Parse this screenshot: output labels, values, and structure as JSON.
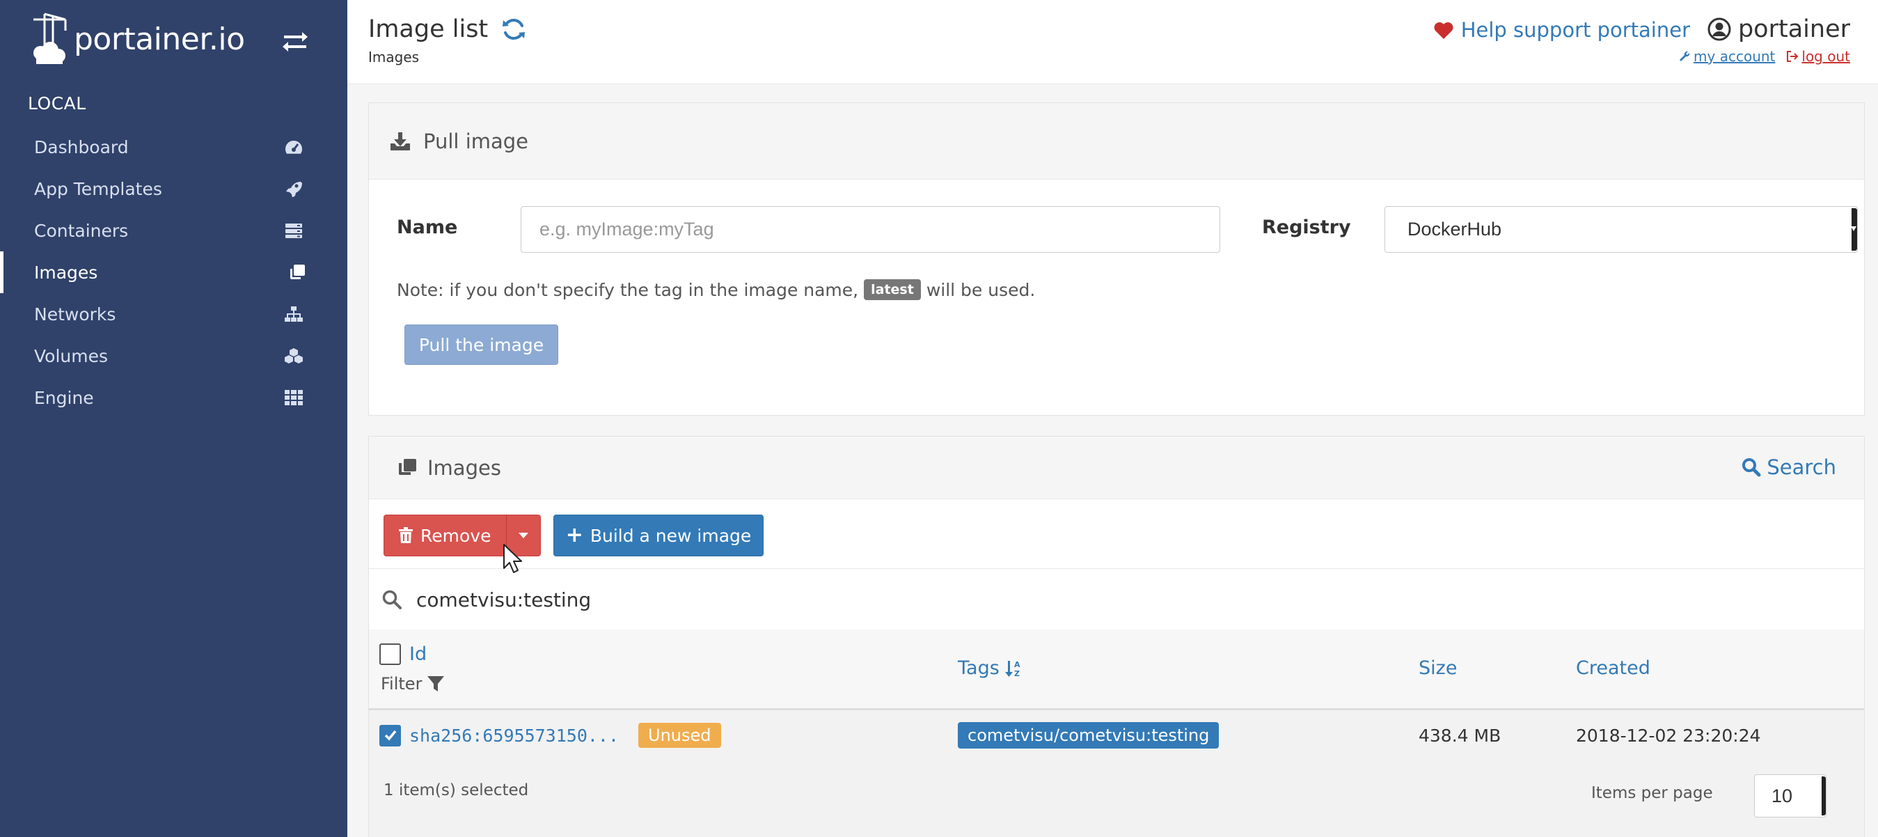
{
  "app": {
    "brand": "portainer.io"
  },
  "sidebar": {
    "endpoint": "LOCAL",
    "items": [
      {
        "label": "Dashboard",
        "icon": "tachometer-icon",
        "active": false
      },
      {
        "label": "App Templates",
        "icon": "rocket-icon",
        "active": false
      },
      {
        "label": "Containers",
        "icon": "server-icon",
        "active": false
      },
      {
        "label": "Images",
        "icon": "clone-icon",
        "active": true
      },
      {
        "label": "Networks",
        "icon": "sitemap-icon",
        "active": false
      },
      {
        "label": "Volumes",
        "icon": "cubes-icon",
        "active": false
      },
      {
        "label": "Engine",
        "icon": "th-icon",
        "active": false
      }
    ]
  },
  "header": {
    "title": "Image list",
    "breadcrumb": "Images",
    "support": "Help support portainer",
    "user": "portainer",
    "my_account": "my account",
    "log_out": "log out"
  },
  "pull": {
    "heading": "Pull image",
    "name_label": "Name",
    "name_placeholder": "e.g. myImage:myTag",
    "registry_label": "Registry",
    "registry_value": "DockerHub",
    "note_before": "Note: if you don't specify the tag in the image name,",
    "note_badge": "latest",
    "note_after": "will be used.",
    "button": "Pull the image"
  },
  "images": {
    "heading": "Images",
    "search_link": "Search",
    "remove": "Remove",
    "build": "Build a new image",
    "search_value": "cometvisu:testing",
    "columns": {
      "id": "Id",
      "filter": "Filter",
      "tags": "Tags",
      "size": "Size",
      "created": "Created"
    },
    "rows": [
      {
        "id": "sha256:6595573150...",
        "status": "Unused",
        "tag": "cometvisu/cometvisu:testing",
        "size": "438.4 MB",
        "created": "2018-12-02 23:20:24",
        "checked": true
      }
    ],
    "selected_count": "1 item(s) selected",
    "items_per_page_label": "Items per page",
    "items_per_page": "10"
  },
  "colors": {
    "sidebar_bg": "#30426a",
    "primary": "#337ab7",
    "danger": "#d9534f",
    "warning": "#f0ad4e"
  }
}
